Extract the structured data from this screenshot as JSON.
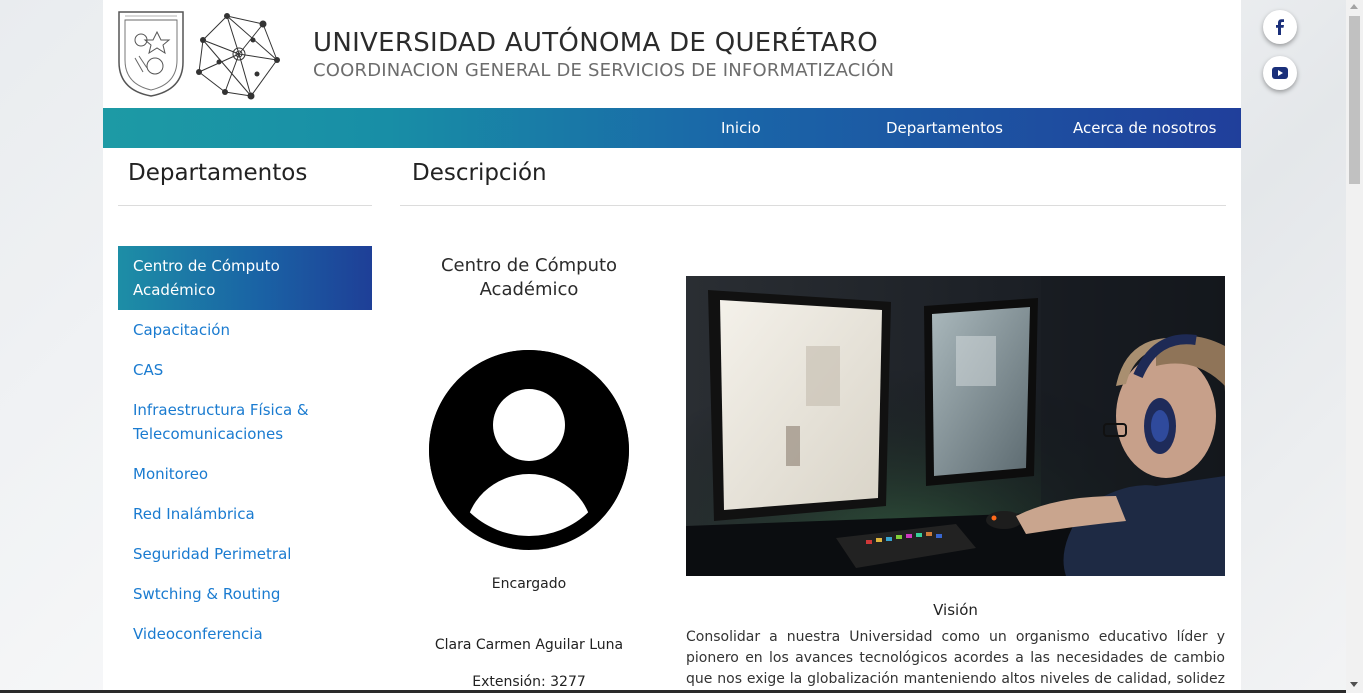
{
  "header": {
    "university": "UNIVERSIDAD AUTÓNOMA DE QUERÉTARO",
    "coordination": "COORDINACION GENERAL DE SERVICIOS DE INFORMATIZACIÓN"
  },
  "nav": {
    "items": [
      {
        "label": "Inicio"
      },
      {
        "label": "Departamentos"
      },
      {
        "label": "Acerca de nosotros"
      }
    ]
  },
  "sidebar": {
    "heading": "Departamentos",
    "items": [
      {
        "label": "Centro de Cómputo Académico",
        "active": true
      },
      {
        "label": "Capacitación"
      },
      {
        "label": "CAS"
      },
      {
        "label": "Infraestructura Física & Telecomunicaciones"
      },
      {
        "label": "Monitoreo"
      },
      {
        "label": "Red Inalámbrica"
      },
      {
        "label": "Seguridad Perimetral"
      },
      {
        "label": "Swtching & Routing"
      },
      {
        "label": "Videoconferencia"
      }
    ]
  },
  "main": {
    "heading": "Descripción",
    "department_title": "Centro de Cómputo Académico",
    "encargado_label": "Encargado",
    "person_name": "Clara Carmen Aguilar Luna",
    "extension": "Extensión: 3277",
    "vision_title": "Visión",
    "vision_text": "Consolidar a nuestra Universidad como un organismo educativo líder y pionero en los avances tecnológicos acordes a las necesidades de cambio que nos exige la globalización manteniendo altos niveles de calidad, solidez y eficacia en los"
  },
  "social": {
    "icons": [
      "facebook-icon",
      "youtube-icon"
    ]
  },
  "colors": {
    "accent_blue": "#1a7bd0",
    "nav_gradient_start": "#1d9aa5",
    "nav_gradient_end": "#203f9b"
  }
}
